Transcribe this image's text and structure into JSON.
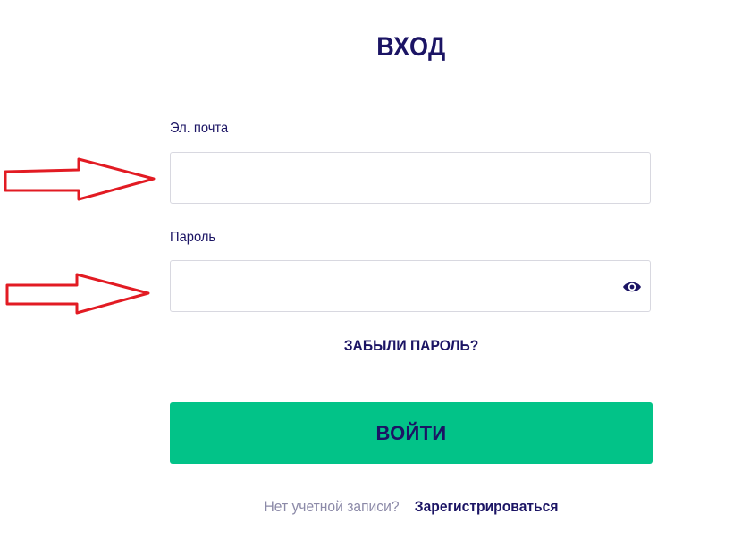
{
  "header": {
    "title": "ВХОД"
  },
  "form": {
    "email_label": "Эл. почта",
    "email_value": "",
    "password_label": "Пароль",
    "password_value": "",
    "forgot_label": "ЗАБЫЛИ ПАРОЛЬ?",
    "submit_label": "ВОЙТИ"
  },
  "footer": {
    "no_account_text": "Нет учетной записи?",
    "register_label": "Зарегистрироваться"
  },
  "icons": {
    "password_toggle": "eye-icon",
    "annotation": "red-arrow-icon"
  },
  "colors": {
    "primary_text": "#1b1464",
    "accent_button": "#02c388",
    "muted_text": "#8c8aa8",
    "annotation_arrow": "#e21b23",
    "input_border": "#d8d8e0"
  }
}
